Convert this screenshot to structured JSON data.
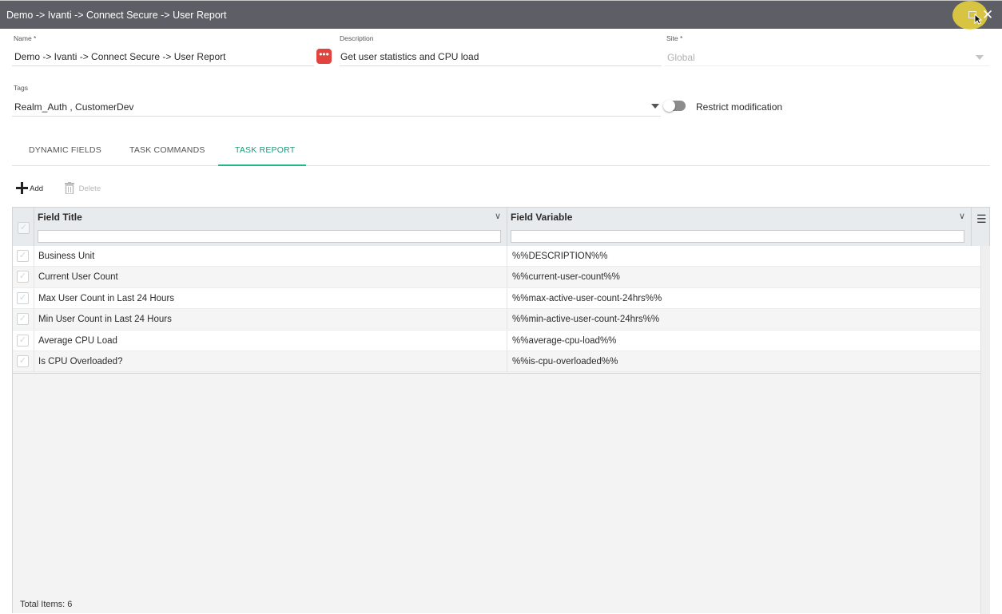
{
  "window": {
    "title": "Demo -> Ivanti -> Connect Secure -> User Report"
  },
  "form": {
    "name_label": "Name *",
    "name_value": "Demo -> Ivanti -> Connect Secure -> User Report",
    "description_label": "Description",
    "description_value": "Get user statistics and CPU load",
    "site_label": "Site *",
    "site_value": "Global",
    "tags_label": "Tags",
    "tags_value": "Realm_Auth , CustomerDev",
    "restrict_label": "Restrict modification",
    "restrict_enabled": false
  },
  "tabs": [
    {
      "label": "DYNAMIC FIELDS",
      "active": false
    },
    {
      "label": "TASK COMMANDS",
      "active": false
    },
    {
      "label": "TASK REPORT",
      "active": true
    }
  ],
  "toolbar": {
    "add_label": "Add",
    "delete_label": "Delete"
  },
  "grid": {
    "columns": [
      "Field Title",
      "Field Variable"
    ],
    "filter_values": [
      "",
      ""
    ],
    "rows": [
      {
        "title": "Business Unit",
        "variable": "%%DESCRIPTION%%"
      },
      {
        "title": "Current User Count",
        "variable": "%%current-user-count%%"
      },
      {
        "title": "Max User Count in Last 24 Hours",
        "variable": "%%max-active-user-count-24hrs%%"
      },
      {
        "title": "Min User Count in Last 24 Hours",
        "variable": "%%min-active-user-count-24hrs%%"
      },
      {
        "title": "Average CPU Load",
        "variable": "%%average-cpu-load%%"
      },
      {
        "title": "Is CPU Overloaded?",
        "variable": "%%is-cpu-overloaded%%"
      }
    ],
    "total_label": "Total Items: 6"
  },
  "icons": {
    "close": "close-icon",
    "restore": "restore-window-icon",
    "more": "more-dots-icon",
    "add": "plus-icon",
    "delete": "trash-icon",
    "column_menu": "hamburger-menu-icon",
    "accent_color": "#1f9c7a",
    "more_button_color": "#e2433e"
  }
}
